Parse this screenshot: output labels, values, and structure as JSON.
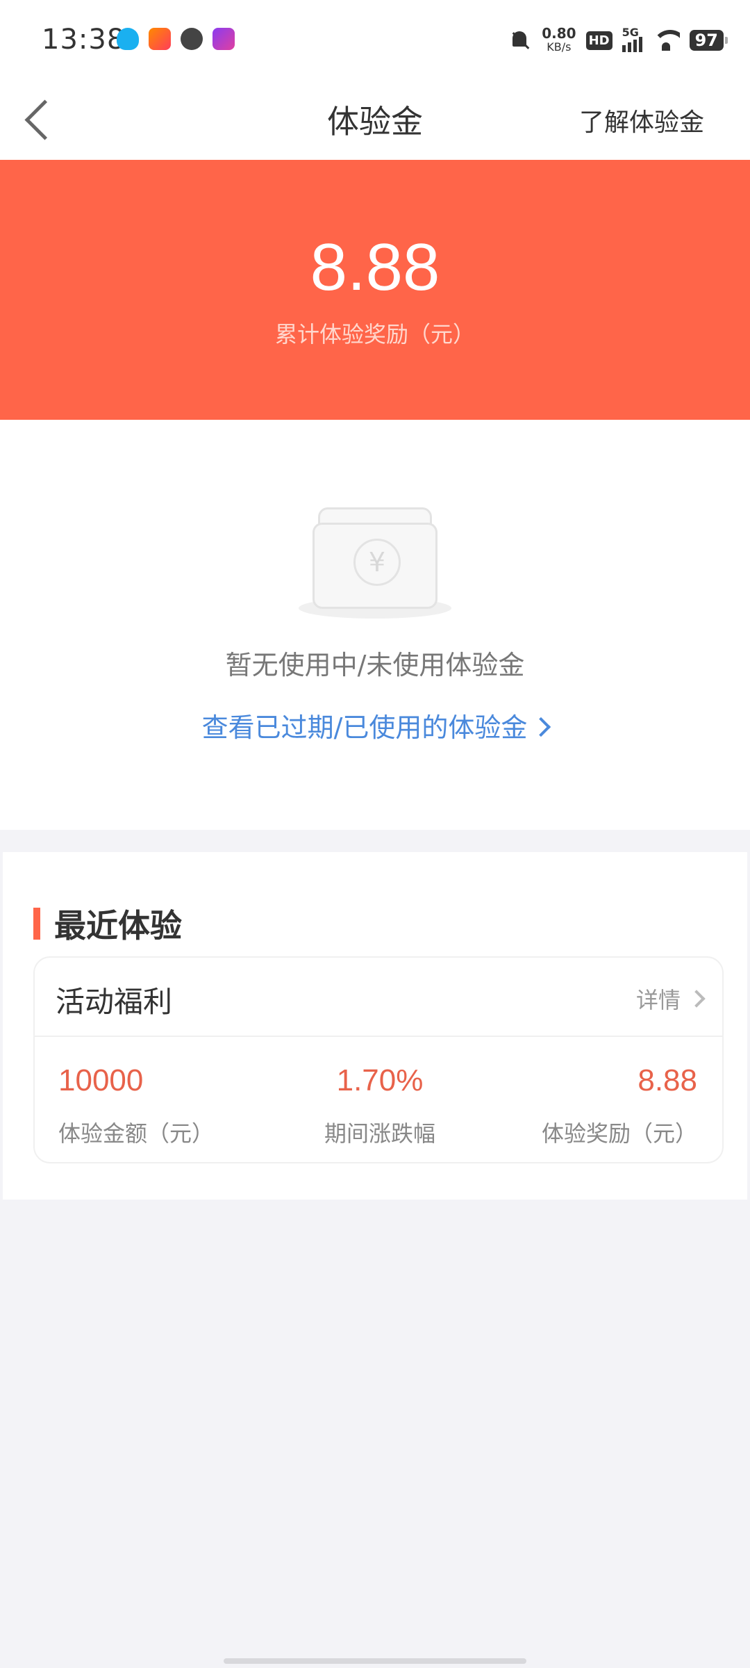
{
  "status_bar": {
    "time": "13:38",
    "net_speed": "0.80",
    "net_unit": "KB/s",
    "hd": "HD",
    "network": "5G",
    "battery": "97"
  },
  "nav": {
    "title": "体验金",
    "right_link": "了解体验金"
  },
  "banner": {
    "amount": "8.88",
    "label": "累计体验奖励（元）"
  },
  "empty_state": {
    "icon": "wallet-yuan-icon",
    "coin_symbol": "¥",
    "message": "暂无使用中/未使用体验金",
    "link": "查看已过期/已使用的体验金"
  },
  "recent": {
    "title": "最近体验",
    "card": {
      "title": "活动福利",
      "detail": "详情",
      "stats": [
        {
          "value": "10000",
          "label": "体验金额（元）"
        },
        {
          "value": "1.70%",
          "label": "期间涨跌幅"
        },
        {
          "value": "8.88",
          "label": "体验奖励（元）"
        }
      ]
    }
  },
  "colors": {
    "brand": "#ff6549",
    "link": "#4a89dc",
    "value": "#e8624a"
  }
}
